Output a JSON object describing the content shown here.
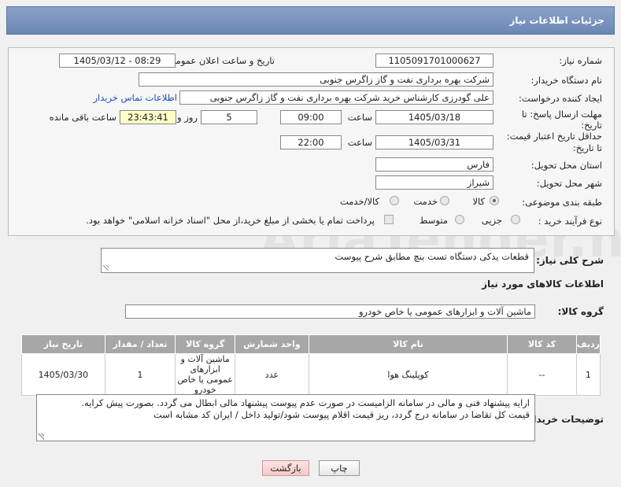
{
  "header": {
    "title": "جزئیات اطلاعات نیاز"
  },
  "form": {
    "need_number_label": "شماره نیاز:",
    "need_number": "1105091701000627",
    "announce_label": "تاریخ و ساعت اعلان عمومی:",
    "announce_value": "1405/03/12 - 08:29",
    "buyer_org_label": "نام دستگاه خریدار:",
    "buyer_org": "شرکت بهره برداری نفت و گاز زاگرس جنوبی",
    "requester_label": "ایجاد کننده درخواست:",
    "requester": "علی گودرزی کارشناس خرید شرکت بهره برداری نفت و گاز زاگرس جنوبی",
    "contact_link": "اطلاعات تماس خریدار",
    "deadline_label_1": "مهلت ارسال پاسخ: تا",
    "deadline_label_2": "تاریخ:",
    "deadline_date": "1405/03/18",
    "time_label": "ساعت",
    "deadline_time": "09:00",
    "days_value": "5",
    "days_label": "روز و",
    "remaining_value": "23:43:41",
    "remaining_label": "ساعت باقی مانده",
    "validity_label_1": "حداقل تاریخ اعتبار قیمت:",
    "validity_label_2": "تا تاریخ:",
    "validity_date": "1405/03/31",
    "validity_time": "22:00",
    "province_label": "استان محل تحویل:",
    "province": "فارس",
    "city_label": "شهر محل تحویل:",
    "city": "شیراز",
    "category_label": "طبقه بندی موضوعی:",
    "category_options": [
      "کالا",
      "خدمت",
      "کالا/خدمت"
    ],
    "process_label": "نوع فرآیند خرید :",
    "process_options": [
      "جزیی",
      "متوسط"
    ],
    "payment_note": "پرداخت تمام یا بخشی از مبلغ خرید،از محل \"اسناد خزانه اسلامی\" خواهد بود."
  },
  "summary": {
    "label": "شرح کلی نیاز:",
    "value": "قطعات یدکی دستگاه تست بنچ مطابق شرح پیوست"
  },
  "goods": {
    "section_title": "اطلاعات کالاهای مورد نیاز",
    "group_label": "گروه کالا:",
    "group_value": "ماشین آلات و ابزارهای عمومی یا خاص خودرو"
  },
  "table": {
    "headers": [
      "ردیف",
      "کد کالا",
      "نام کالا",
      "واحد شمارش",
      "گروه کالا",
      "تعداد / مقدار",
      "تاریخ نیاز"
    ],
    "rows": [
      [
        "1",
        "--",
        "کوپلینگ هوا",
        "عدد",
        "ماشین آلات و ابزارهای عمومی یا خاص خودرو",
        "1",
        "1405/03/30"
      ]
    ]
  },
  "notes": {
    "label": "توضیحات خریدار:",
    "line1": "ارایه پیشنهاد فنی و مالی در سامانه الزامیست در صورت عدم پیوست پیشنهاد مالی ابطال می گردد. بصورت پیش کرایه.",
    "line2": "قیمت کل تقاضا در سامانه درج گردد، ریز قیمت اقلام پیوست شود/تولید داخل / ایران کد مشابه است"
  },
  "buttons": {
    "print": "چاپ",
    "back": "بازگشت"
  },
  "watermark": "AriaTender.net",
  "colors": {
    "header": "#7b95bf",
    "link": "#1e4fb0",
    "table_header": "#a7a7a7",
    "back_button": "#f4c8c8"
  }
}
